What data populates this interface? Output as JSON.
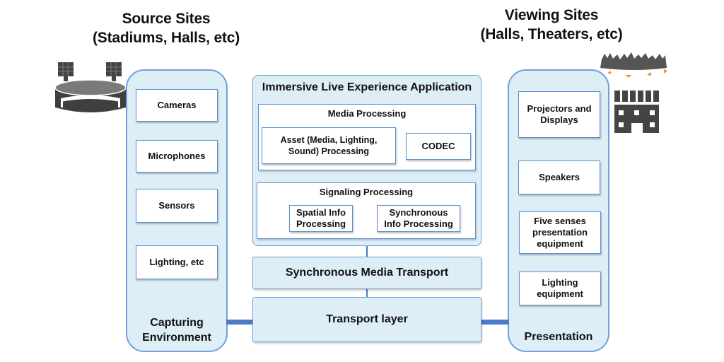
{
  "source_sites": {
    "title_line1": "Source Sites",
    "title_line2": "(Stadiums, Halls, etc)",
    "icon": "stadium-icon"
  },
  "viewing_sites": {
    "title_line1": "Viewing Sites",
    "title_line2": "(Halls, Theaters, etc)",
    "icon": "theater-crowd-icon"
  },
  "capturing": {
    "label_line1": "Capturing",
    "label_line2": "Environment",
    "items": [
      "Cameras",
      "Microphones",
      "Sensors",
      "Lighting, etc"
    ]
  },
  "presentation": {
    "label": "Presentation",
    "items": [
      {
        "line1": "Projectors and",
        "line2": "Displays",
        "line3": ""
      },
      {
        "line1": "Speakers",
        "line2": "",
        "line3": ""
      },
      {
        "line1": "Five senses",
        "line2": "presentation",
        "line3": "equipment"
      },
      {
        "line1": "Lighting",
        "line2": "equipment",
        "line3": ""
      }
    ]
  },
  "application": {
    "title": "Immersive Live Experience Application",
    "media_processing": {
      "title": "Media Processing",
      "asset_line1": "Asset (Media, Lighting,",
      "asset_line2": "Sound) Processing",
      "codec": "CODEC"
    },
    "signaling_processing": {
      "title": "Signaling Processing",
      "spatial_line1": "Spatial Info",
      "spatial_line2": "Processing",
      "sync_line1": "Synchronous",
      "sync_line2": "Info Processing"
    }
  },
  "sync_media_transport": "Synchronous Media Transport",
  "transport_layer": "Transport layer",
  "colors": {
    "panel_fill": "#ddeef6",
    "border": "#6fa0d8",
    "connector": "#4a7bc4",
    "icon_gray": "#444444",
    "accent_orange": "#f08a2a"
  }
}
